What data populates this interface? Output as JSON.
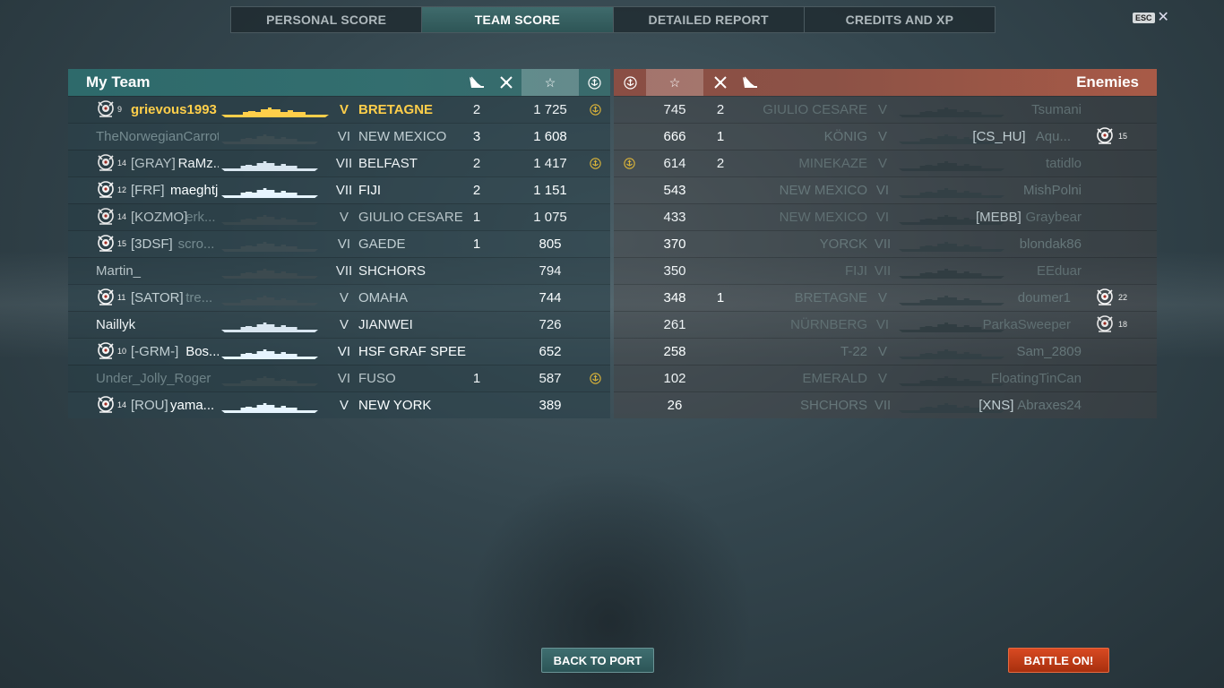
{
  "tabs": [
    {
      "label": "PERSONAL SCORE",
      "active": false
    },
    {
      "label": "TEAM SCORE",
      "active": true
    },
    {
      "label": "DETAILED REPORT",
      "active": false
    },
    {
      "label": "CREDITS AND XP",
      "active": false
    }
  ],
  "esc": {
    "key": "ESC",
    "close_icon": "close-icon"
  },
  "my_team": {
    "title": "My Team",
    "header_icons": [
      "torpedo-icon",
      "planes-icon",
      "star-icon",
      "anchor-icon"
    ],
    "rows": [
      {
        "rank": "9",
        "clan": "",
        "name": "grievous1993",
        "tier": "V",
        "ship": "BRETAGNE",
        "kills": "2",
        "score": "1 725",
        "anchor": true,
        "style": "gold",
        "badge": true
      },
      {
        "rank": "",
        "clan": "",
        "name": "TheNorwegianCarrot",
        "tier": "VI",
        "ship": "NEW MEXICO",
        "kills": "3",
        "score": "1 608",
        "anchor": false,
        "style": "dim",
        "badge": false
      },
      {
        "rank": "14",
        "clan": "[GRAY]",
        "name": "RaMz...",
        "tier": "VII",
        "ship": "BELFAST",
        "kills": "2",
        "score": "1 417",
        "anchor": true,
        "style": "bright",
        "badge": true
      },
      {
        "rank": "12",
        "clan": "[FRF]",
        "name": "maeghtjp",
        "tier": "VII",
        "ship": "FIJI",
        "kills": "2",
        "score": "1 151",
        "anchor": false,
        "style": "bright",
        "badge": true
      },
      {
        "rank": "14",
        "clan": "[KOZMO]",
        "name": "erk...",
        "tier": "V",
        "ship": "GIULIO CESARE",
        "kills": "1",
        "score": "1 075",
        "anchor": false,
        "style": "dim",
        "badge": true
      },
      {
        "rank": "15",
        "clan": "[3DSF]",
        "name": "scro...",
        "tier": "VI",
        "ship": "GAEDE",
        "kills": "1",
        "score": "805",
        "anchor": false,
        "style": "dim",
        "badge": true
      },
      {
        "rank": "",
        "clan": "",
        "name": "Martin_",
        "tier": "VII",
        "ship": "SHCHORS",
        "kills": "",
        "score": "794",
        "anchor": false,
        "style": "mid",
        "badge": false
      },
      {
        "rank": "11",
        "clan": "[SATOR]",
        "name": "tre...",
        "tier": "V",
        "ship": "OMAHA",
        "kills": "",
        "score": "744",
        "anchor": false,
        "style": "dim",
        "badge": true
      },
      {
        "rank": "",
        "clan": "",
        "name": "Naillyk",
        "tier": "V",
        "ship": "JIANWEI",
        "kills": "",
        "score": "726",
        "anchor": false,
        "style": "bright",
        "badge": false
      },
      {
        "rank": "10",
        "clan": "[-GRM-]",
        "name": "Bos...",
        "tier": "VI",
        "ship": "HSF GRAF SPEE",
        "kills": "",
        "score": "652",
        "anchor": false,
        "style": "bright",
        "badge": true
      },
      {
        "rank": "",
        "clan": "",
        "name": "Under_Jolly_Roger",
        "tier": "VI",
        "ship": "FUSO",
        "kills": "1",
        "score": "587",
        "anchor": true,
        "style": "dim",
        "badge": false
      },
      {
        "rank": "14",
        "clan": "[ROU]",
        "name": "yama...",
        "tier": "V",
        "ship": "NEW YORK",
        "kills": "",
        "score": "389",
        "anchor": false,
        "style": "bright",
        "badge": true
      }
    ]
  },
  "enemies": {
    "title": "Enemies",
    "header_icons": [
      "anchor-icon",
      "star-icon",
      "planes-icon",
      "torpedo-icon"
    ],
    "rows": [
      {
        "anchor": false,
        "score": "745",
        "kills": "2",
        "ship": "GIULIO CESARE",
        "tier": "V",
        "clan": "",
        "name": "Tsumani",
        "rank": "",
        "badge": false
      },
      {
        "anchor": false,
        "score": "666",
        "kills": "1",
        "ship": "KÖNIG",
        "tier": "V",
        "clan": "[CS_HU]",
        "name": "Aqu...",
        "rank": "15",
        "badge": true
      },
      {
        "anchor": true,
        "score": "614",
        "kills": "2",
        "ship": "MINEKAZE",
        "tier": "V",
        "clan": "",
        "name": "tatidlo",
        "rank": "",
        "badge": false
      },
      {
        "anchor": false,
        "score": "543",
        "kills": "",
        "ship": "NEW MEXICO",
        "tier": "VI",
        "clan": "",
        "name": "MishPolni",
        "rank": "",
        "badge": false
      },
      {
        "anchor": false,
        "score": "433",
        "kills": "",
        "ship": "NEW MEXICO",
        "tier": "VI",
        "clan": "[MEBB]",
        "name": "Graybear",
        "rank": "",
        "badge": false
      },
      {
        "anchor": false,
        "score": "370",
        "kills": "",
        "ship": "YORCK",
        "tier": "VII",
        "clan": "",
        "name": "blondak86",
        "rank": "",
        "badge": false
      },
      {
        "anchor": false,
        "score": "350",
        "kills": "",
        "ship": "FIJI",
        "tier": "VII",
        "clan": "",
        "name": "EEduar",
        "rank": "",
        "badge": false
      },
      {
        "anchor": false,
        "score": "348",
        "kills": "1",
        "ship": "BRETAGNE",
        "tier": "V",
        "clan": "",
        "name": "doumer1",
        "rank": "22",
        "badge": true
      },
      {
        "anchor": false,
        "score": "261",
        "kills": "",
        "ship": "NÜRNBERG",
        "tier": "VI",
        "clan": "",
        "name": "ParkaSweeper",
        "rank": "18",
        "badge": true
      },
      {
        "anchor": false,
        "score": "258",
        "kills": "",
        "ship": "T-22",
        "tier": "V",
        "clan": "",
        "name": "Sam_2809",
        "rank": "",
        "badge": false
      },
      {
        "anchor": false,
        "score": "102",
        "kills": "",
        "ship": "EMERALD",
        "tier": "V",
        "clan": "",
        "name": "FloatingTinCan",
        "rank": "",
        "badge": false
      },
      {
        "anchor": false,
        "score": "26",
        "kills": "",
        "ship": "SHCHORS",
        "tier": "VII",
        "clan": "[XNS]",
        "name": "Abraxes24",
        "rank": "",
        "badge": false
      }
    ]
  },
  "buttons": {
    "back": "BACK TO PORT",
    "battle": "BATTLE ON!"
  },
  "colors": {
    "my_team_header": "#2e6a6b",
    "enemy_header": "#a85a47",
    "player_highlight": "#ffcf4a",
    "battle_button": "#c83c18"
  }
}
